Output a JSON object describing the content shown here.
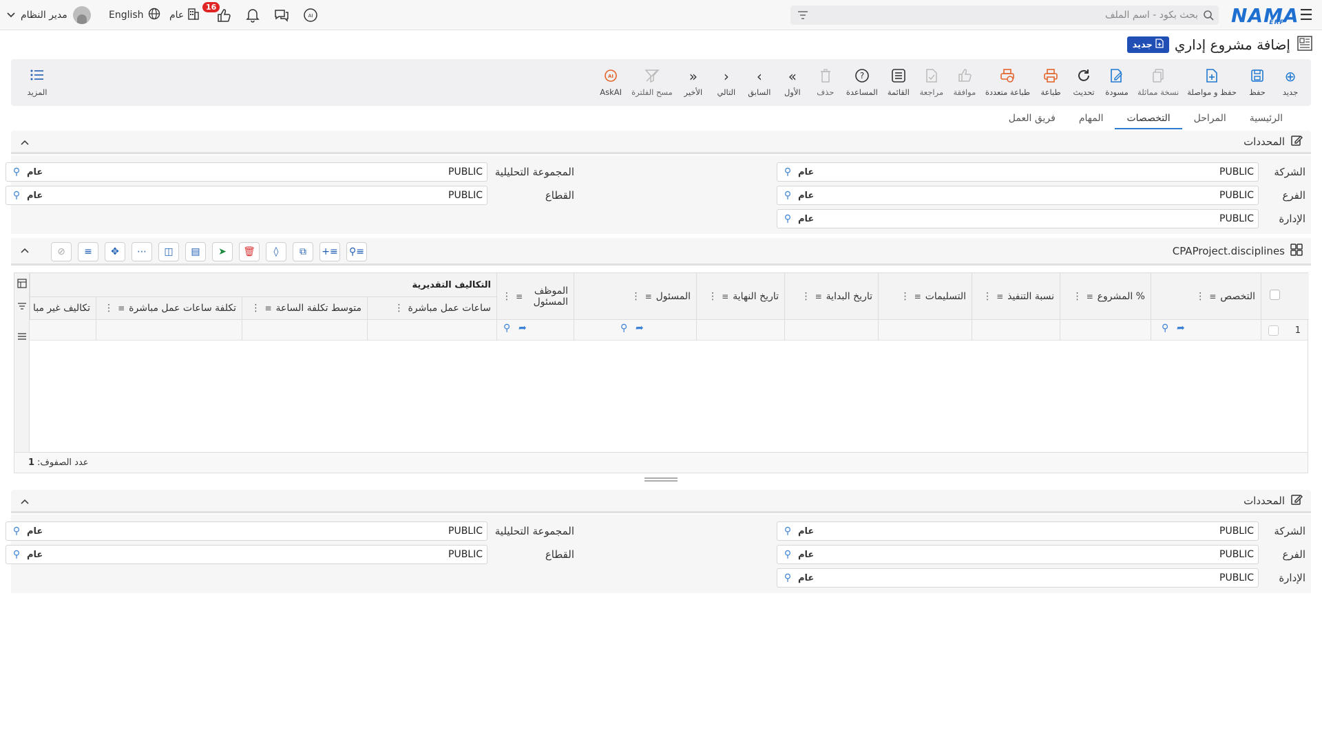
{
  "topbar": {
    "logo": "NAMA",
    "logo_sub": "ERP",
    "search_placeholder": "بحث بكود - اسم الملف",
    "notifications_count": "16",
    "general_label": "عام",
    "language": "English",
    "user_name": "مدير النظام"
  },
  "page": {
    "title": "إضافة مشروع إداري",
    "status_badge": "جديد"
  },
  "toolbar": {
    "items": [
      {
        "label": "جديد",
        "icon": "plus-circle-icon"
      },
      {
        "label": "حفظ",
        "icon": "save-icon"
      },
      {
        "label": "حفظ و مواصلة",
        "icon": "save-continue-icon"
      },
      {
        "label": "نسخة مماثلة",
        "icon": "copy-icon"
      },
      {
        "label": "مسودة",
        "icon": "draft-icon"
      },
      {
        "label": "تحديث",
        "icon": "refresh-icon"
      },
      {
        "label": "طباعة",
        "icon": "print-icon"
      },
      {
        "label": "طباعة متعددة",
        "icon": "multi-print-icon"
      },
      {
        "label": "موافقة",
        "icon": "thumbs-up-icon"
      },
      {
        "label": "مراجعة",
        "icon": "review-icon"
      },
      {
        "label": "القائمة",
        "icon": "list-icon"
      },
      {
        "label": "المساعدة",
        "icon": "help-icon"
      },
      {
        "label": "حذف",
        "icon": "trash-icon"
      },
      {
        "label": "الأول",
        "icon": "first-icon"
      },
      {
        "label": "السابق",
        "icon": "previous-icon"
      },
      {
        "label": "التالي",
        "icon": "next-icon"
      },
      {
        "label": "الأخير",
        "icon": "last-icon"
      },
      {
        "label": "مسح الفلترة",
        "icon": "clear-filter-icon"
      },
      {
        "label": "AskAI",
        "icon": "ai-icon"
      }
    ],
    "more_label": "المزيد"
  },
  "tabs": [
    "الرئيسية",
    "المراحل",
    "التخصصات",
    "المهام",
    "فريق العمل"
  ],
  "active_tab": "التخصصات",
  "dimensions": {
    "title": "المحددات",
    "company_label": "الشركة",
    "branch_label": "الفرع",
    "department_label": "الإدارة",
    "analysis_group_label": "المجموعة التحليلية",
    "sector_label": "القطاع",
    "value": "PUBLIC",
    "desc": "عام"
  },
  "grid": {
    "title": "CPAProject.disciplines",
    "group_header": "التكاليف التقديرية",
    "columns": {
      "discipline": "التخصص",
      "project_pct": "% المشروع",
      "exec_pct": "نسبة التنفيذ",
      "deliverables": "التسليمات",
      "start_date": "تاريخ البداية",
      "end_date": "تاريخ النهاية",
      "responsible": "المسئول",
      "responsible_employee": "الموظف المسئول",
      "direct_hours": "ساعات عمل مباشرة",
      "avg_hour_cost": "متوسط تكلفة الساعة",
      "direct_hours_cost": "تكلفة ساعات عمل مباشرة",
      "indirect_costs": "تكاليف غير مبا"
    },
    "row_number": "1",
    "row_count_label": "عدد الصفوف:",
    "row_count": "1"
  }
}
